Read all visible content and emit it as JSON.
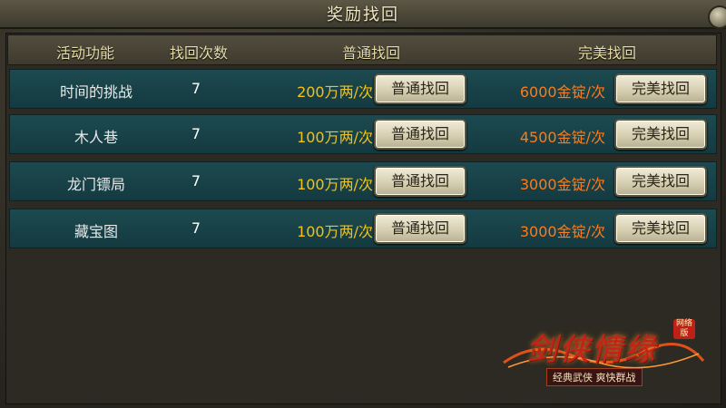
{
  "window": {
    "title": "奖励找回"
  },
  "header": {
    "col_activity": "活动功能",
    "col_count": "找回次数",
    "col_normal": "普通找回",
    "col_perfect": "完美找回"
  },
  "rows": [
    {
      "name": "时间的挑战",
      "count": "7",
      "normal_cost": "200万两/次",
      "normal_btn": "普通找回",
      "perfect_cost": "6000金锭/次",
      "perfect_btn": "完美找回"
    },
    {
      "name": "木人巷",
      "count": "7",
      "normal_cost": "100万两/次",
      "normal_btn": "普通找回",
      "perfect_cost": "4500金锭/次",
      "perfect_btn": "完美找回"
    },
    {
      "name": "龙门镖局",
      "count": "7",
      "normal_cost": "100万两/次",
      "normal_btn": "普通找回",
      "perfect_cost": "3000金锭/次",
      "perfect_btn": "完美找回"
    },
    {
      "name": "藏宝图",
      "count": "7",
      "normal_cost": "100万两/次",
      "normal_btn": "普通找回",
      "perfect_cost": "3000金锭/次",
      "perfect_btn": "完美找回"
    }
  ],
  "logo": {
    "main": "剑侠情缘",
    "badge": "网络版",
    "sub": "经典武侠 爽快群战"
  },
  "colors": {
    "row_bg": "#1c4a50",
    "normal_cost": "#f2c21a",
    "perfect_cost": "#ff7a1a",
    "title": "#f0e6c0"
  },
  "icons": {
    "close": "close-icon"
  }
}
